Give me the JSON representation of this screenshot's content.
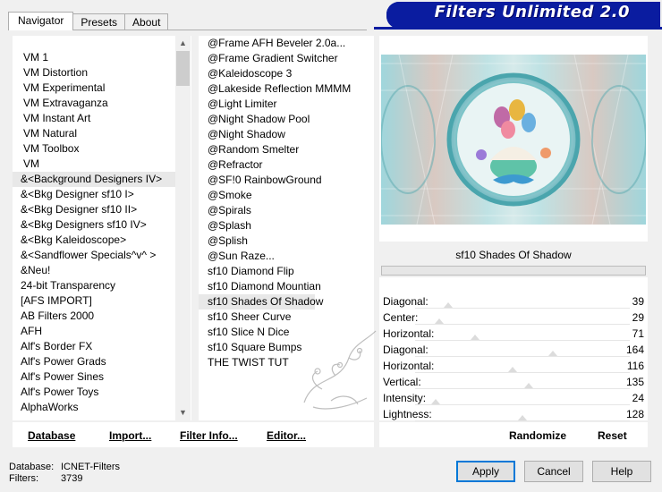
{
  "tabs": [
    {
      "label": "Navigator",
      "active": true
    },
    {
      "label": "Presets",
      "active": false
    },
    {
      "label": "About",
      "active": false
    }
  ],
  "banner": {
    "title": "Filters Unlimited 2.0"
  },
  "categories": [
    "VM 1",
    "VM Distortion",
    "VM Experimental",
    "VM Extravaganza",
    "VM Instant Art",
    "VM Natural",
    "VM Toolbox",
    "VM",
    "&<Background Designers IV>",
    "&<Bkg Designer sf10 I>",
    "&<Bkg Designer sf10 II>",
    "&<Bkg Designers sf10 IV>",
    "&<Bkg Kaleidoscope>",
    "&<Sandflower Specials^v^ >",
    "&Neu!",
    "24-bit Transparency",
    "[AFS IMPORT]",
    "AB Filters 2000",
    "AFH",
    "Alf's Border FX",
    "Alf's Power Grads",
    "Alf's Power Sines",
    "Alf's Power Toys",
    "AlphaWorks"
  ],
  "selected_category_index": 8,
  "filters": [
    "@Frame AFH Beveler 2.0a...",
    "@Frame Gradient Switcher",
    "@Kaleidoscope 3",
    "@Lakeside Reflection MMMM",
    "@Light Limiter",
    "@Night Shadow Pool",
    "@Night Shadow",
    "@Random Smelter",
    "@Refractor",
    "@SF!0 RainbowGround",
    "@Smoke",
    "@Spirals",
    "@Splash",
    "@Splish",
    "@Sun Raze...",
    "sf10 Diamond Flip",
    "sf10 Diamond Mountian",
    "sf10 Shades Of Shadow",
    "sf10 Sheer Curve",
    "sf10 Slice N Dice",
    "sf10 Square Bumps",
    "THE TWIST TUT"
  ],
  "selected_filter_index": 17,
  "left_buttons": {
    "database": "Database",
    "import": "Import...",
    "filter_info": "Filter Info...",
    "editor": "Editor..."
  },
  "preview": {
    "filter_name": "sf10 Shades Of Shadow"
  },
  "parameters": [
    {
      "label": "Diagonal:",
      "value": "39",
      "level": 0.153
    },
    {
      "label": "Center:",
      "value": "29",
      "level": 0.114
    },
    {
      "label": "Horizontal:",
      "value": "71",
      "level": 0.278
    },
    {
      "label": "Diagonal:",
      "value": "164",
      "level": 0.643
    },
    {
      "label": "Horizontal:",
      "value": "116",
      "level": 0.455
    },
    {
      "label": "Vertical:",
      "value": "135",
      "level": 0.529
    },
    {
      "label": "Intensity:",
      "value": "24",
      "level": 0.094
    },
    {
      "label": "Lightness:",
      "value": "128",
      "level": 0.502
    }
  ],
  "right_buttons": {
    "randomize": "Randomize",
    "reset": "Reset"
  },
  "footer": {
    "database_label": "Database:",
    "database_value": "ICNET-Filters",
    "filters_label": "Filters:",
    "filters_value": "3739"
  },
  "dialog_buttons": {
    "apply": "Apply",
    "cancel": "Cancel",
    "help": "Help"
  },
  "colors": {
    "banner": "#0a1ca0",
    "selection": "#e8e8e8",
    "default_button_border": "#0078d7"
  },
  "icons": {
    "scroll_up": "chevron-up-icon",
    "scroll_down": "chevron-down-icon"
  }
}
